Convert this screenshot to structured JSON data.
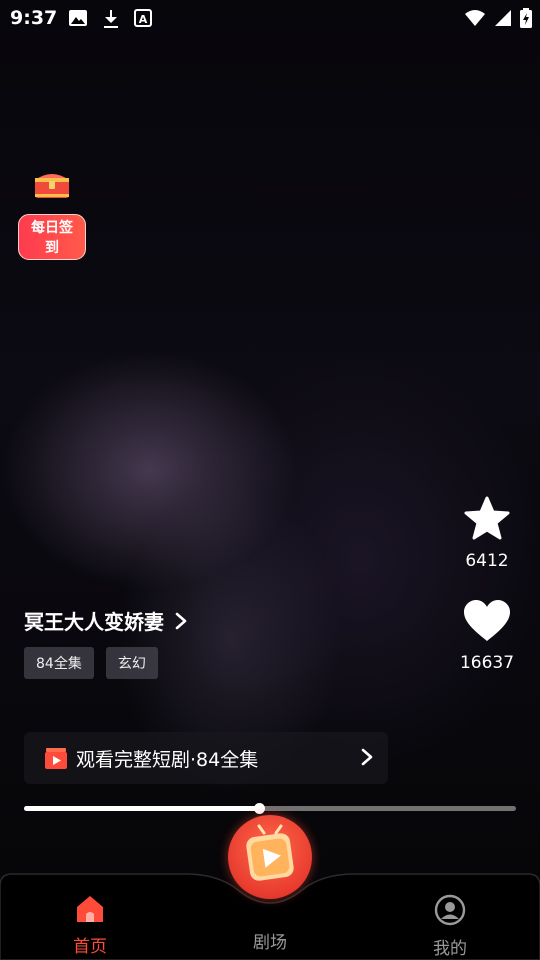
{
  "status_bar": {
    "time": "9:37",
    "left_icons": [
      "image-icon",
      "download-icon",
      "font-a-icon"
    ],
    "right_icons": [
      "wifi-icon",
      "signal-icon",
      "battery-icon"
    ]
  },
  "checkin": {
    "label": "每日签到",
    "icon": "treasure-chest-icon"
  },
  "actions": {
    "favorite": {
      "icon": "star-icon",
      "count": "6412"
    },
    "like": {
      "icon": "heart-icon",
      "count": "16637"
    }
  },
  "drama": {
    "title": "冥王大人变娇妻",
    "tags": [
      "84全集",
      "玄幻"
    ]
  },
  "watch_full": {
    "label": "观看完整短剧·84全集"
  },
  "progress": {
    "fraction": 0.478
  },
  "tabs": [
    {
      "label": "首页",
      "icon": "home-icon",
      "active": true
    },
    {
      "label": "剧场",
      "icon": "tv-icon",
      "active": false
    },
    {
      "label": "我的",
      "icon": "profile-icon",
      "active": false
    }
  ],
  "colors": {
    "accent": "#ff4b3a",
    "tab_inactive": "#9a9a9a"
  }
}
